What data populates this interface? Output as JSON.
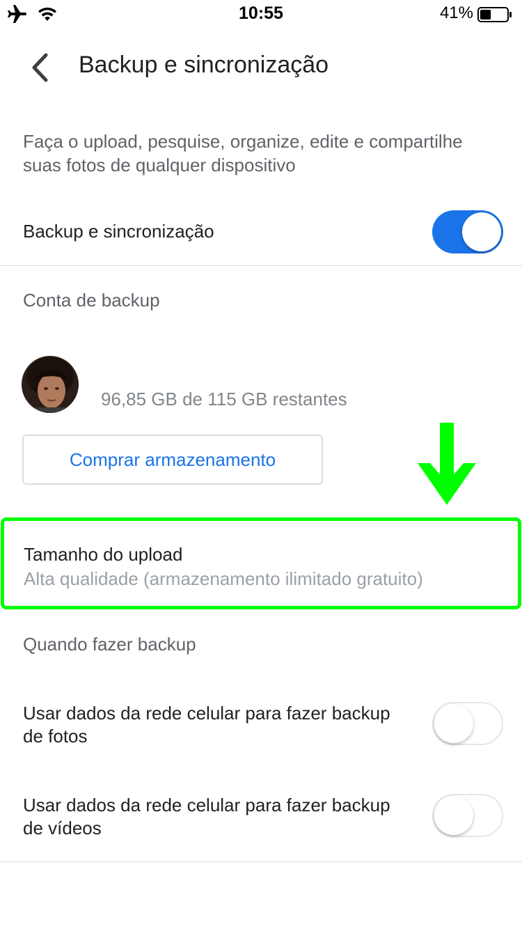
{
  "status_bar": {
    "time": "10:55",
    "battery_percent": "41%",
    "battery_level": 0.41
  },
  "header": {
    "title": "Backup e sincronização"
  },
  "intro_text": "Faça o upload, pesquise, organize, edite e compartilhe suas fotos de qualquer dispositivo",
  "backup_sync": {
    "label": "Backup e sincronização",
    "enabled": true
  },
  "backup_account": {
    "header": "Conta de backup",
    "storage_remaining": "96,85 GB de 115 GB restantes",
    "buy_storage_label": "Comprar armazenamento"
  },
  "upload_size": {
    "title": "Tamanho do upload",
    "value": "Alta qualidade (armazenamento ilimitado gratuito)"
  },
  "when_backup": {
    "header": "Quando fazer backup",
    "cellular_photos_label": "Usar dados da rede celular para fazer backup de fotos",
    "cellular_photos_enabled": false,
    "cellular_videos_label": "Usar dados da rede celular para fazer backup de vídeos",
    "cellular_videos_enabled": false
  },
  "colors": {
    "accent": "#1a73e8",
    "highlight": "#00ff00"
  }
}
